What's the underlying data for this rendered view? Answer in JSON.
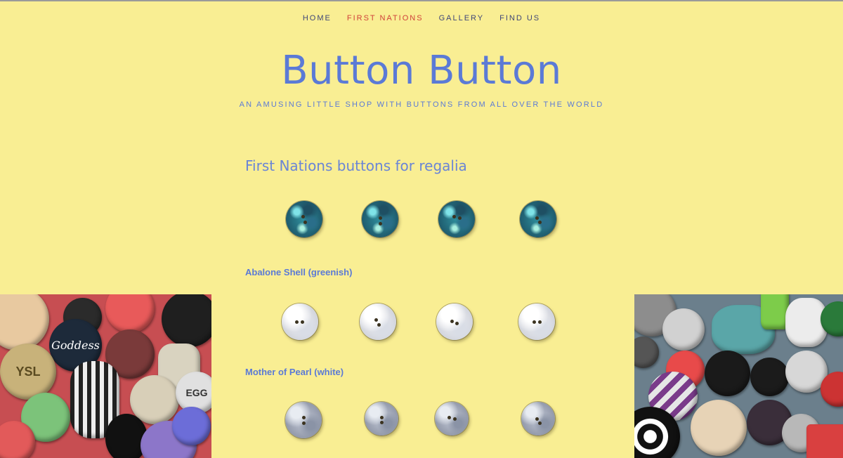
{
  "nav": {
    "items": [
      {
        "label": "HOME",
        "active": false
      },
      {
        "label": "FIRST NATIONS",
        "active": true
      },
      {
        "label": "GALLERY",
        "active": false
      },
      {
        "label": "FIND US",
        "active": false
      }
    ]
  },
  "header": {
    "title": "Button Button",
    "tagline": "AN AMUSING LITTLE SHOP WITH BUTTONS FROM ALL OVER THE WORLD"
  },
  "main": {
    "heading": "First Nations buttons for regalia",
    "groups": [
      {
        "caption": "Abalone Shell (greenish)",
        "style": "abalone"
      },
      {
        "caption": "Mother of Pearl (white)",
        "style": "pearl"
      },
      {
        "caption": "",
        "style": "grey"
      }
    ]
  },
  "decor": {
    "left_photo_buttons": [
      {
        "text": "Goddess"
      },
      {
        "text": "YSL"
      },
      {
        "text": "EGG"
      }
    ]
  },
  "colors": {
    "background": "#f9ee93",
    "accent_blue": "#5b7ad6",
    "nav_text": "#3f4678",
    "nav_active": "#d0403a"
  }
}
